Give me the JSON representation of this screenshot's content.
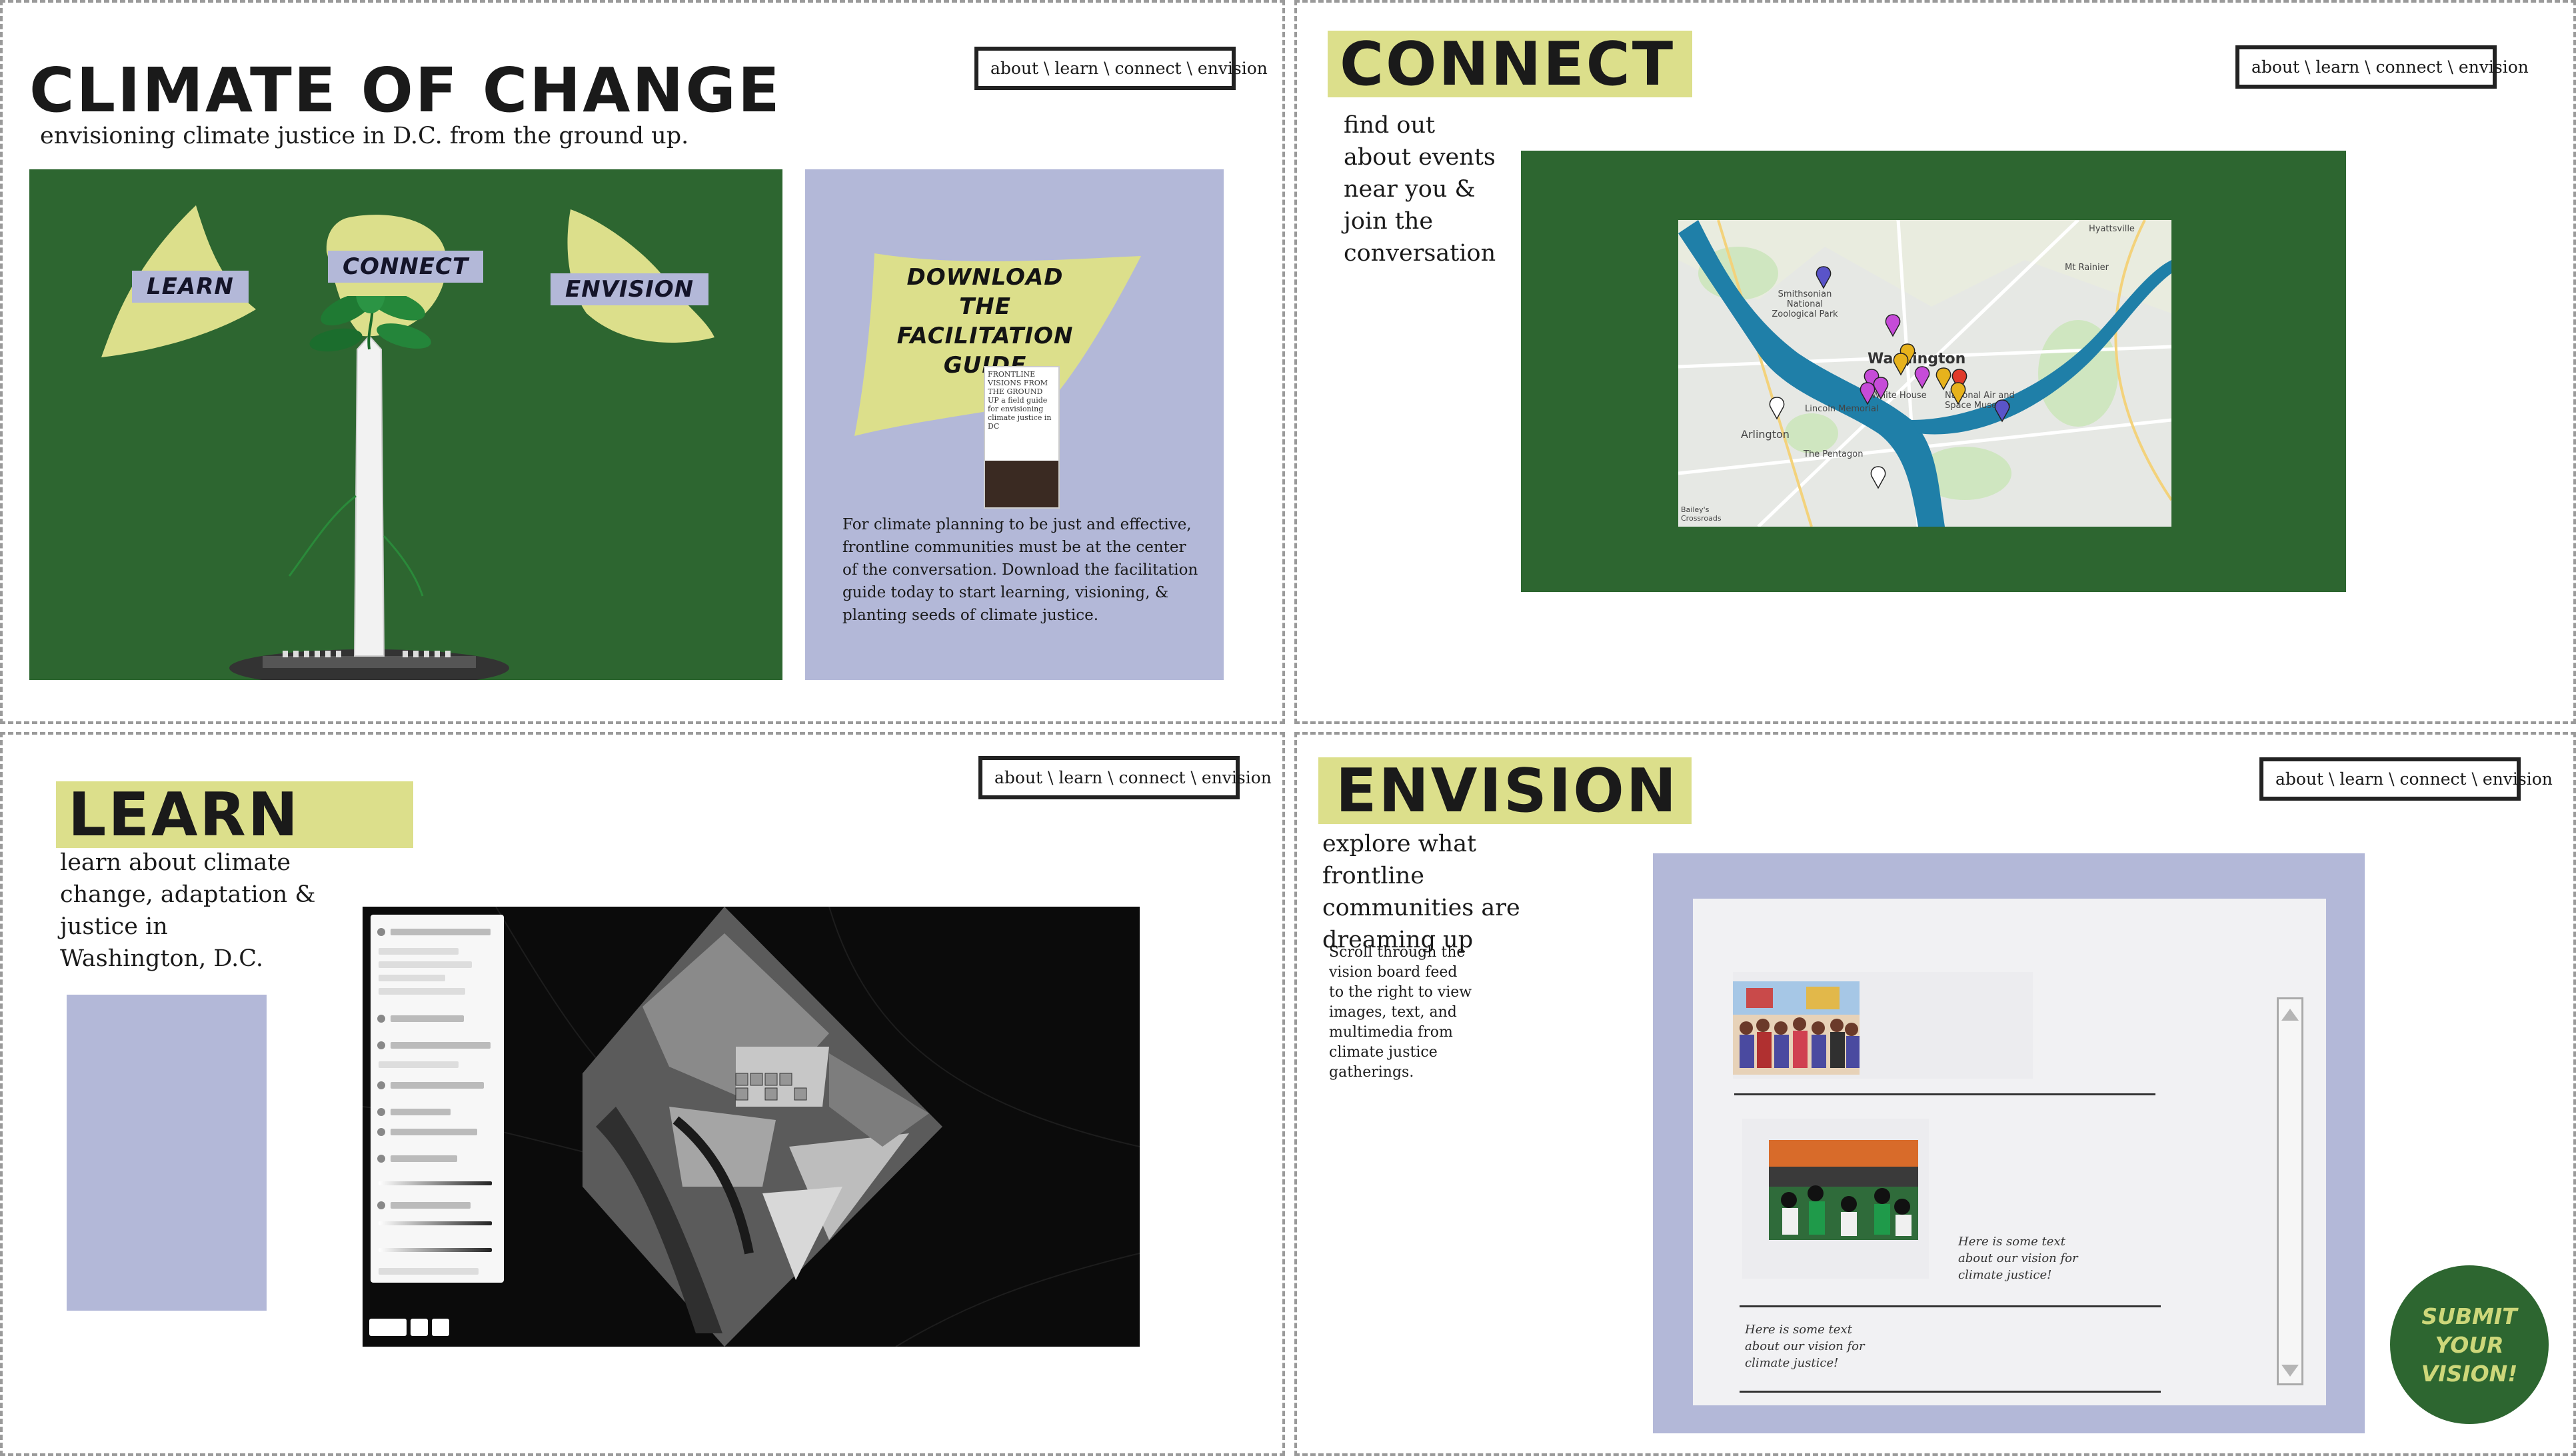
{
  "nav": {
    "text": "about \\ learn \\ connect \\ envision"
  },
  "about": {
    "title": "CLIMATE OF CHANGE",
    "subtitle": "envisioning climate justice in D.C. from the ground up.",
    "hero_links": {
      "learn": "LEARN",
      "connect": "CONNECT",
      "envision": "ENVISION"
    },
    "guide": {
      "title": "DOWNLOAD THE FACILITATION GUIDE",
      "cover_text": "FRONTLINE VISIONS FROM THE GROUND UP a field guide for envisioning climate justice in DC",
      "body": "For climate planning to be just and effective, frontline communities must be at the center of the conversation. Download the facilitation guide today to start learning, visioning, & planting seeds of climate justice."
    }
  },
  "connect": {
    "title": "CONNECT",
    "intro": "find out about events near you & join the conversation",
    "map_labels": {
      "washington": "Washington",
      "arlington": "Arlington",
      "pentagon": "The Pentagon",
      "zoo": "Smithsonian National Zoological Park",
      "lincoln": "Lincoln Memorial",
      "white_house": "White House",
      "museum": "National Air and Space Museum",
      "hyattsville": "Hyattsville",
      "mt_rainier": "Mt Rainier",
      "baileys": "Bailey's Crossroads"
    }
  },
  "learn": {
    "title": "LEARN",
    "intro": "learn about climate change, adaptation & justice in Washington, D.C."
  },
  "envision": {
    "title": "ENVISION",
    "intro": "explore what frontline communities are dreaming up",
    "instructions": "Scroll through the vision board feed to the right to view images, text, and multimedia from climate justice gatherings.",
    "captions": [
      "Here is some text about our vision for climate justice!",
      "Here is some text about our vision for climate justice!"
    ],
    "submit": "SUBMIT YOUR VISION!"
  },
  "colors": {
    "dark_green": "#2d6630",
    "lavender": "#b3b8d8",
    "yellow_green": "#dcdf8b"
  }
}
